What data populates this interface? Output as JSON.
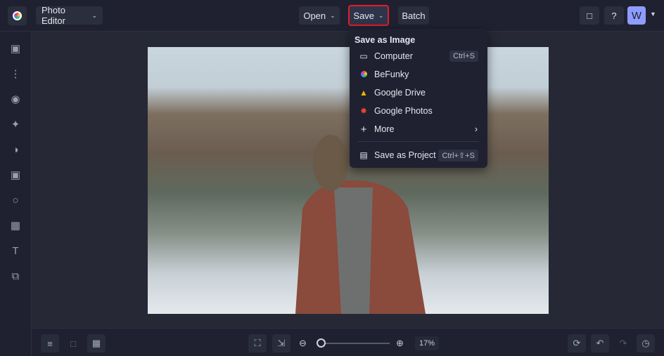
{
  "header": {
    "app_menu": "Photo Editor",
    "open": "Open",
    "save": "Save",
    "batch": "Batch",
    "avatar": "W"
  },
  "save_menu": {
    "heading": "Save as Image",
    "items": [
      {
        "label": "Computer",
        "shortcut": "Ctrl+S",
        "icon": "monitor-icon"
      },
      {
        "label": "BeFunky",
        "icon": "befunky-icon"
      },
      {
        "label": "Google Drive",
        "icon": "google-drive-icon"
      },
      {
        "label": "Google Photos",
        "icon": "google-photos-icon"
      },
      {
        "label": "More",
        "icon": "plus-icon"
      },
      {
        "label": "Save as Project",
        "shortcut": "Ctrl+⇧+S",
        "icon": "briefcase-icon"
      }
    ]
  },
  "bottom": {
    "zoom": "17%",
    "zoom_fraction": 0.03
  },
  "colors": {
    "accent": "#6c7cff",
    "highlight": "#e11d2a"
  }
}
